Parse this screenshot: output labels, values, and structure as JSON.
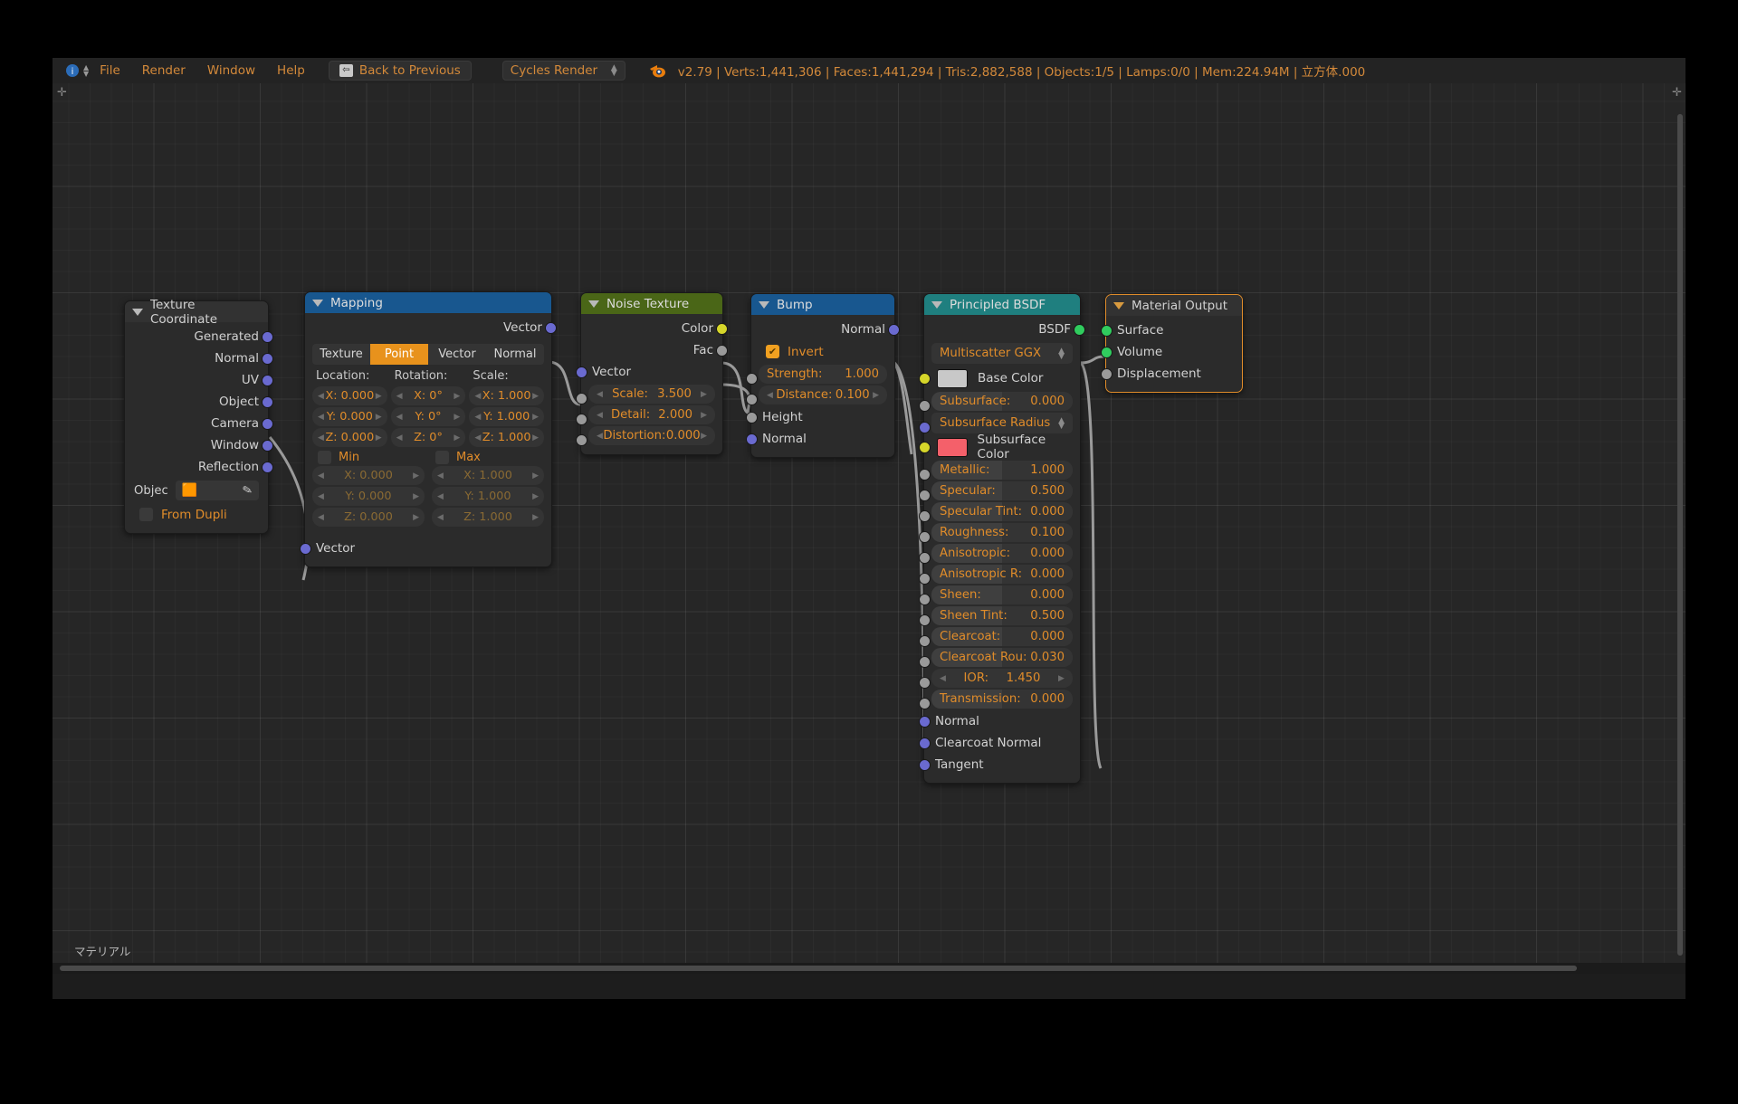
{
  "topbar": {
    "info_icon": "info-icon",
    "menus": [
      "File",
      "Render",
      "Window",
      "Help"
    ],
    "back_button": "Back to Previous",
    "back_icon": "back-arrow-icon",
    "engine": "Cycles Render",
    "blender_logo": "blender-logo-icon",
    "status": "v2.79 | Verts:1,441,306 | Faces:1,441,294 | Tris:2,882,588 | Objects:1/5 | Lamps:0/0 | Mem:224.94M | 立方体.000"
  },
  "editor": {
    "label": "マテリアル",
    "corner_tl": "+",
    "corner_tr": "+"
  },
  "nodes": {
    "texcoord": {
      "title": "Texture Coordinate",
      "outputs": [
        "Generated",
        "Normal",
        "UV",
        "Object",
        "Camera",
        "Window",
        "Reflection"
      ],
      "object_label": "Objec",
      "object_icon": "cube-icon",
      "eyedropper_icon": "eyedropper-icon",
      "from_dupli": "From Dupli"
    },
    "mapping": {
      "title": "Mapping",
      "output": "Vector",
      "tabs": [
        "Texture",
        "Point",
        "Vector",
        "Normal"
      ],
      "active_tab": "Point",
      "headers": {
        "location": "Location:",
        "rotation": "Rotation:",
        "scale": "Scale:"
      },
      "location": [
        "X: 0.000",
        "Y: 0.000",
        "Z: 0.000"
      ],
      "rotation": [
        "X:   0°",
        "Y:   0°",
        "Z:   0°"
      ],
      "scale": [
        "X: 1.000",
        "Y: 1.000",
        "Z: 1.000"
      ],
      "minmax": {
        "min": "Min",
        "max": "Max"
      },
      "min_values": [
        "X:        0.000",
        "Y:        0.000",
        "Z:        0.000"
      ],
      "max_values": [
        "X:        1.000",
        "Y:        1.000",
        "Z:        1.000"
      ],
      "input": "Vector"
    },
    "noise": {
      "title": "Noise Texture",
      "outputs": [
        "Color",
        "Fac"
      ],
      "input": "Vector",
      "fields": [
        {
          "label": "Scale:",
          "value": "3.500"
        },
        {
          "label": "Detail:",
          "value": "2.000"
        },
        {
          "label": "Distortion:",
          "value": "0.000"
        }
      ]
    },
    "bump": {
      "title": "Bump",
      "output": "Normal",
      "invert": "Invert",
      "invert_checked": true,
      "fields": [
        {
          "label": "Strength:",
          "value": "1.000"
        },
        {
          "label": "Distance:",
          "value": "0.100"
        }
      ],
      "inputs": [
        "Height",
        "Normal"
      ]
    },
    "bsdf": {
      "title": "Principled BSDF",
      "output": "BSDF",
      "distribution": "Multiscatter GGX",
      "base_color_label": "Base Color",
      "base_color": "#c8c8c8",
      "subsurface_color_label": "Subsurface Color",
      "subsurface_color": "#f4606a",
      "subsurface_radius_label": "Subsurface Radius",
      "fields": [
        {
          "label": "Subsurface:",
          "value": "0.000"
        },
        {
          "label": "Metallic:",
          "value": "1.000"
        },
        {
          "label": "Specular:",
          "value": "0.500"
        },
        {
          "label": "Specular Tint:",
          "value": "0.000"
        },
        {
          "label": "Roughness:",
          "value": "0.100"
        },
        {
          "label": "Anisotropic:",
          "value": "0.000"
        },
        {
          "label": "Anisotropic R:",
          "value": "0.000"
        },
        {
          "label": "Sheen:",
          "value": "0.000"
        },
        {
          "label": "Sheen Tint:",
          "value": "0.500"
        },
        {
          "label": "Clearcoat:",
          "value": "0.000"
        },
        {
          "label": "Clearcoat Rou:",
          "value": "0.030"
        },
        {
          "label": "IOR:",
          "value": "1.450"
        },
        {
          "label": "Transmission:",
          "value": "0.000"
        }
      ],
      "inputs": [
        "Normal",
        "Clearcoat Normal",
        "Tangent"
      ]
    },
    "output": {
      "title": "Material Output",
      "inputs": [
        "Surface",
        "Volume",
        "Displacement"
      ],
      "selected": true
    }
  },
  "colors": {
    "header_vector": "#18578f",
    "header_texture": "#4a6617",
    "header_shader": "#1f7f7f",
    "header_plain": "#323232",
    "accent_orange": "#e08c2a",
    "socket_vector": "#6a6ad0",
    "socket_color": "#d6d62a",
    "socket_gray": "#9a9a9a",
    "socket_shader": "#30cc5e",
    "selection": "#e08c2a"
  }
}
